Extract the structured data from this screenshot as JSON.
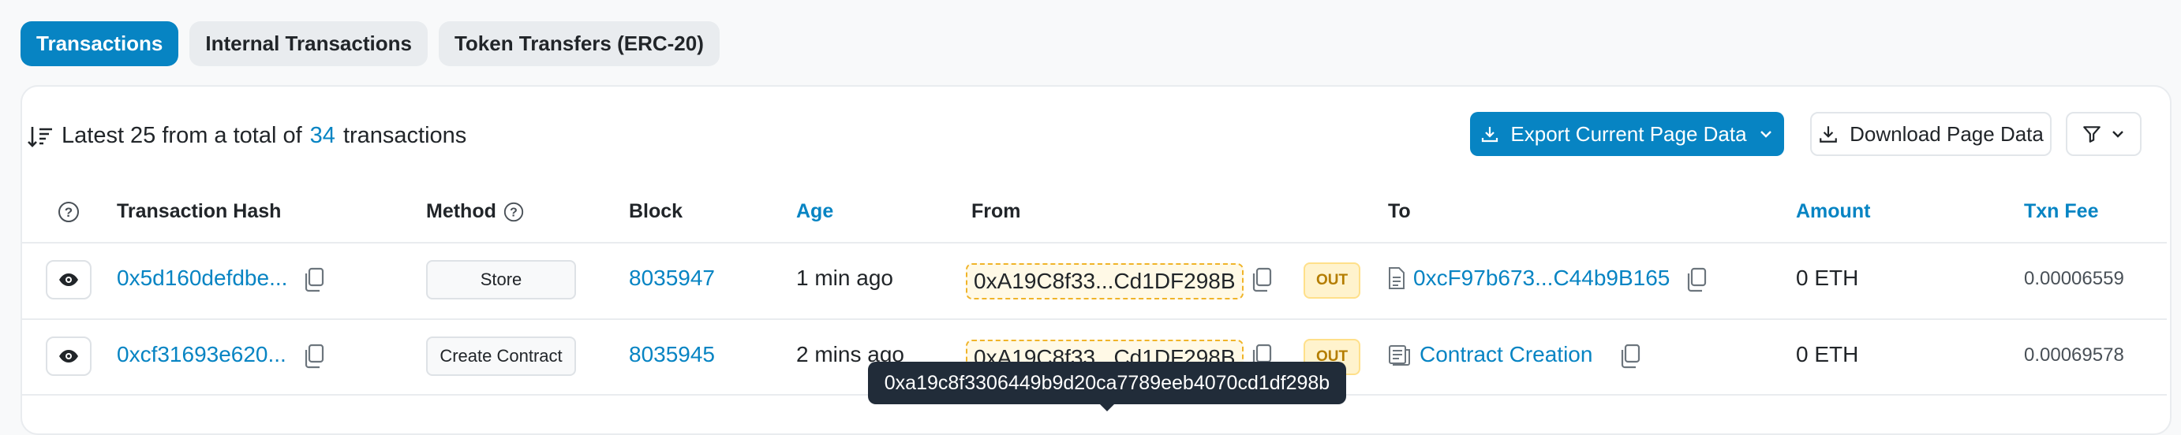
{
  "tabs": [
    {
      "label": "Transactions",
      "active": true
    },
    {
      "label": "Internal Transactions",
      "active": false
    },
    {
      "label": "Token Transfers (ERC-20)",
      "active": false
    }
  ],
  "summary": {
    "prefix": "Latest 25 from a total of",
    "count": "34",
    "suffix": "transactions"
  },
  "actions": {
    "export_label": "Export Current Page Data",
    "download_label": "Download Page Data"
  },
  "columns": {
    "hash": "Transaction Hash",
    "method": "Method",
    "block": "Block",
    "age": "Age",
    "from": "From",
    "to": "To",
    "amount": "Amount",
    "fee": "Txn Fee"
  },
  "rows": [
    {
      "hash": "0x5d160defdbe...",
      "method": "Store",
      "block": "8035947",
      "age": "1 min ago",
      "from": "0xA19C8f33...Cd1DF298B",
      "direction": "OUT",
      "to": "0xcF97b673...C44b9B165",
      "amount": "0 ETH",
      "fee": "0.00006559"
    },
    {
      "hash": "0xcf31693e620...",
      "method": "Create Contract",
      "block": "8035945",
      "age": "2 mins ago",
      "from": "0xA19C8f33...Cd1DF298B",
      "direction": "OUT",
      "to": "Contract Creation",
      "amount": "0 ETH",
      "fee": "0.00069578"
    }
  ],
  "tooltip": "0xa19c8f3306449b9d20ca7789eeb4070cd1df298b",
  "colors": {
    "accent": "#0784c3",
    "highlight_bg": "#fff9e6",
    "highlight_border": "#f0b429",
    "tooltip_bg": "#212c39"
  }
}
